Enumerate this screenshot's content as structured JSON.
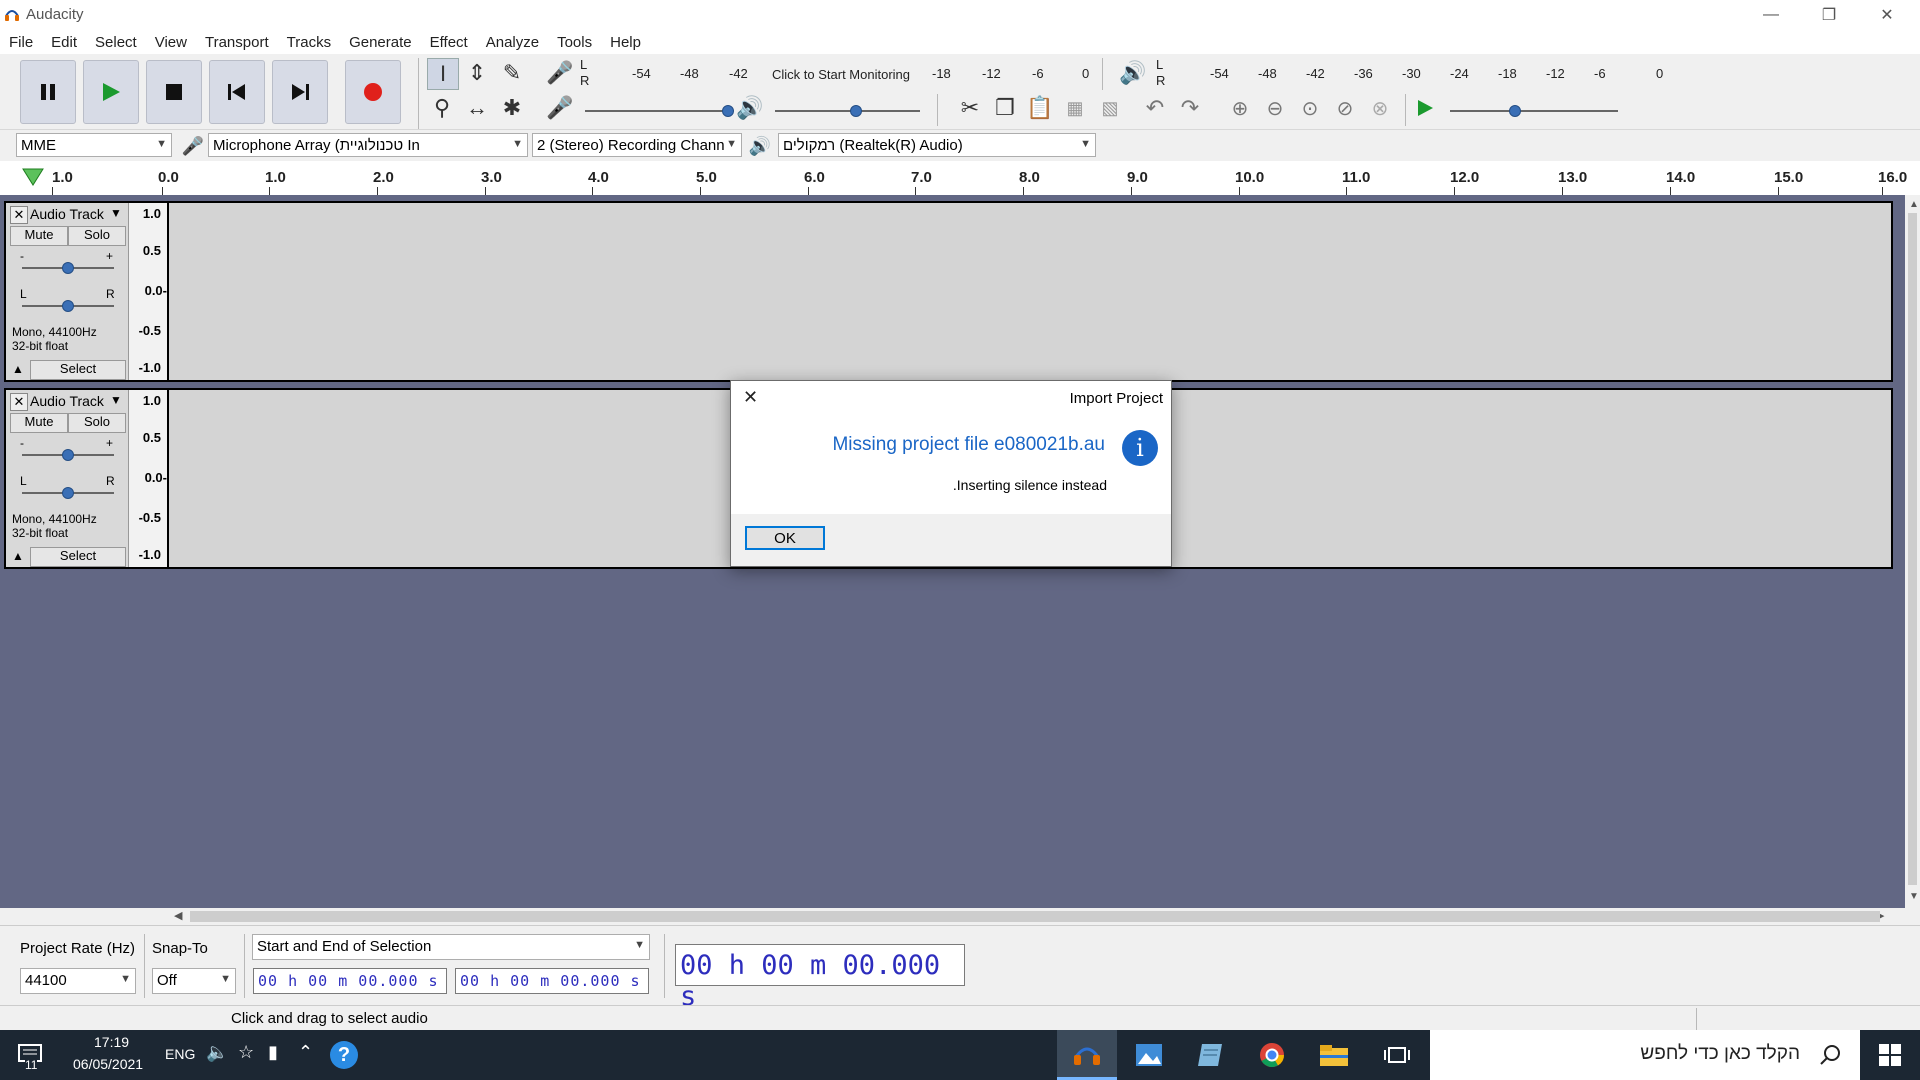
{
  "window": {
    "title": "Audacity"
  },
  "menu": [
    "File",
    "Edit",
    "Select",
    "View",
    "Transport",
    "Tracks",
    "Generate",
    "Effect",
    "Analyze",
    "Tools",
    "Help"
  ],
  "meters": {
    "record_scale": [
      "-54",
      "-48",
      "-42",
      "Click to Start Monitoring",
      "-18",
      "-12",
      "-6",
      "0"
    ],
    "play_scale": [
      "-54",
      "-48",
      "-42",
      "-36",
      "-30",
      "-24",
      "-18",
      "-12",
      "-6",
      "0"
    ],
    "record_channels": [
      "L",
      "R"
    ],
    "play_channels": [
      "L",
      "R"
    ],
    "record_volume": 0.98,
    "play_volume": 0.55,
    "play_speed": 0.38
  },
  "device": {
    "host": "MME",
    "recording_device": "Microphone Array (טכנולוגיית In",
    "channels": "2 (Stereo) Recording Chann",
    "playback_device": "רמקולים (Realtek(R) Audio)"
  },
  "ruler": [
    "1.0",
    "0.0",
    "1.0",
    "2.0",
    "3.0",
    "4.0",
    "5.0",
    "6.0",
    "7.0",
    "8.0",
    "9.0",
    "10.0",
    "11.0",
    "12.0",
    "13.0",
    "14.0",
    "15.0",
    "16.0"
  ],
  "tracks": [
    {
      "name": "Audio Track",
      "mute": "Mute",
      "solo": "Solo",
      "gain_min": "-",
      "gain_max": "+",
      "pan_left": "L",
      "pan_right": "R",
      "info1": "Mono, 44100Hz",
      "info2": "32-bit float",
      "select": "Select",
      "scale": [
        "1.0",
        "0.5",
        "0.0-",
        "-0.5",
        "-1.0"
      ]
    },
    {
      "name": "Audio Track",
      "mute": "Mute",
      "solo": "Solo",
      "gain_min": "-",
      "gain_max": "+",
      "pan_left": "L",
      "pan_right": "R",
      "info1": "Mono, 44100Hz",
      "info2": "32-bit float",
      "select": "Select",
      "scale": [
        "1.0",
        "0.5",
        "0.0-",
        "-0.5",
        "-1.0"
      ]
    }
  ],
  "selection": {
    "project_rate_label": "Project Rate (Hz)",
    "project_rate": "44100",
    "snap_label": "Snap-To",
    "snap_value": "Off",
    "selection_mode": "Start and End of Selection",
    "start_time": "00 h 00 m 00.000 s",
    "end_time": "00 h 00 m 00.000 s",
    "audio_position": "00 h 00 m 00.000 s"
  },
  "status": {
    "text": "Click and drag to select audio"
  },
  "dialog": {
    "title": "Import Project",
    "heading": "Missing project file e080021b.au",
    "message": ".Inserting silence instead",
    "ok": "OK"
  },
  "taskbar": {
    "time": "17:19",
    "date": "06/05/2021",
    "lang": "ENG",
    "notifications": "11",
    "search_placeholder": "הקלד כאן כדי לחפש"
  },
  "colors": {
    "accent": "#0078d7",
    "track_bg": "#626784",
    "info_blue": "#1a66c6"
  }
}
